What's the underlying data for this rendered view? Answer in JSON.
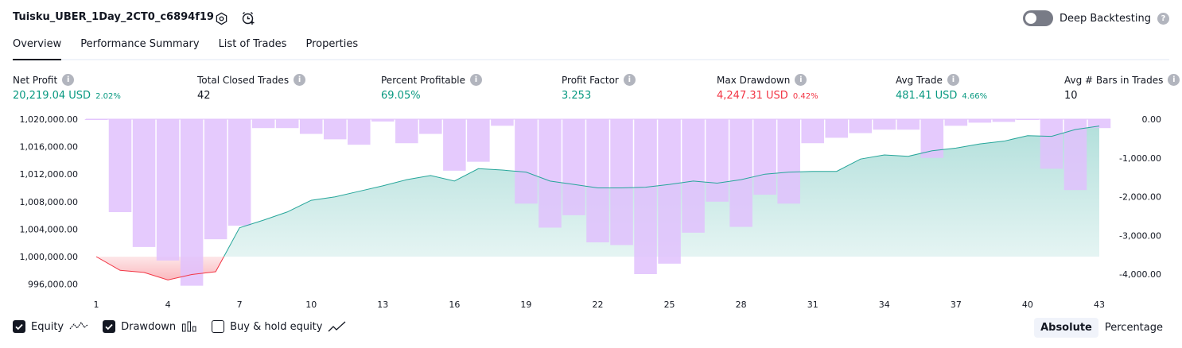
{
  "header": {
    "title": "Tuisku_UBER_1Day_2CT0_c6894f19",
    "deep_backtesting_label": "Deep Backtesting",
    "deep_backtesting_on": false
  },
  "tabs": [
    {
      "label": "Overview",
      "active": true
    },
    {
      "label": "Performance Summary",
      "active": false
    },
    {
      "label": "List of Trades",
      "active": false
    },
    {
      "label": "Properties",
      "active": false
    }
  ],
  "metrics": [
    {
      "label": "Net Profit",
      "value": "20,219.04 USD",
      "pct": "2.02%",
      "tone": "pos"
    },
    {
      "label": "Total Closed Trades",
      "value": "42",
      "pct": "",
      "tone": "neutral"
    },
    {
      "label": "Percent Profitable",
      "value": "69.05%",
      "pct": "",
      "tone": "pos"
    },
    {
      "label": "Profit Factor",
      "value": "3.253",
      "pct": "",
      "tone": "pos"
    },
    {
      "label": "Max Drawdown",
      "value": "4,247.31 USD",
      "pct": "0.42%",
      "tone": "neg"
    },
    {
      "label": "Avg Trade",
      "value": "481.41 USD",
      "pct": "4.66%",
      "tone": "pos"
    },
    {
      "label": "Avg # Bars in Trades",
      "value": "10",
      "pct": "",
      "tone": "neutral"
    }
  ],
  "legend": {
    "equity": {
      "label": "Equity",
      "checked": true
    },
    "drawdown": {
      "label": "Drawdown",
      "checked": true
    },
    "buy_hold": {
      "label": "Buy & hold equity",
      "checked": false
    }
  },
  "scale_toggle": {
    "absolute": "Absolute",
    "percentage": "Percentage",
    "active": "absolute"
  },
  "colors": {
    "equity_line": "#26a69a",
    "drawdown_bar": "#e1c1fd",
    "loss_line": "#f23645",
    "text_pos": "#089981",
    "text_neg": "#f23645"
  },
  "chart_data": {
    "type": "line",
    "x_ticks": [
      "1",
      "4",
      "7",
      "10",
      "13",
      "16",
      "19",
      "22",
      "25",
      "28",
      "31",
      "34",
      "37",
      "40",
      "43"
    ],
    "left_axis": {
      "ticks": [
        "1,020,000.00",
        "1,016,000.00",
        "1,012,000.00",
        "1,008,000.00",
        "1,004,000.00",
        "1,000,000.00",
        "996,000.00"
      ],
      "range": [
        994000,
        1020000
      ]
    },
    "right_axis": {
      "ticks": [
        "0.00",
        "-1,000.00",
        "-2,000.00",
        "-3,000.00",
        "-4,000.00"
      ],
      "range": [
        -4500,
        0
      ]
    },
    "series": [
      {
        "name": "Equity",
        "axis": "left",
        "x": [
          1,
          2,
          3,
          4,
          5,
          6,
          7,
          8,
          9,
          10,
          11,
          12,
          13,
          14,
          15,
          16,
          17,
          18,
          19,
          20,
          21,
          22,
          23,
          24,
          25,
          26,
          27,
          28,
          29,
          30,
          31,
          32,
          33,
          34,
          35,
          36,
          37,
          38,
          39,
          40,
          41,
          42,
          43
        ],
        "values": [
          1000000,
          998000,
          997700,
          996600,
          997400,
          997800,
          1004200,
          1005300,
          1006500,
          1008200,
          1008700,
          1009500,
          1010300,
          1011200,
          1011800,
          1011000,
          1012800,
          1012600,
          1012300,
          1011000,
          1010500,
          1010000,
          1010000,
          1010100,
          1010500,
          1011000,
          1010700,
          1011200,
          1012000,
          1012300,
          1012400,
          1012400,
          1014200,
          1014800,
          1014600,
          1015400,
          1015800,
          1016400,
          1016800,
          1017600,
          1017500,
          1018500,
          1019000
        ]
      },
      {
        "name": "Drawdown",
        "axis": "right",
        "x": [
          1,
          2,
          3,
          4,
          5,
          6,
          7,
          8,
          9,
          10,
          11,
          12,
          13,
          14,
          15,
          16,
          17,
          18,
          19,
          20,
          21,
          22,
          23,
          24,
          25,
          26,
          27,
          28,
          29,
          30,
          31,
          32,
          33,
          34,
          35,
          36,
          37,
          38,
          39,
          40,
          41,
          42,
          43
        ],
        "values": [
          -20,
          -2400,
          -3300,
          -3650,
          -4300,
          -3100,
          -2750,
          -230,
          -230,
          -380,
          -520,
          -660,
          -60,
          -620,
          -380,
          -1330,
          -1100,
          -170,
          -2180,
          -2800,
          -2480,
          -3180,
          -3250,
          -4000,
          -3730,
          -2930,
          -2130,
          -2780,
          -1950,
          -2180,
          -620,
          -480,
          -360,
          -270,
          -270,
          -1000,
          -170,
          -90,
          -70,
          -20,
          -1280,
          -1830,
          -230
        ]
      }
    ]
  }
}
